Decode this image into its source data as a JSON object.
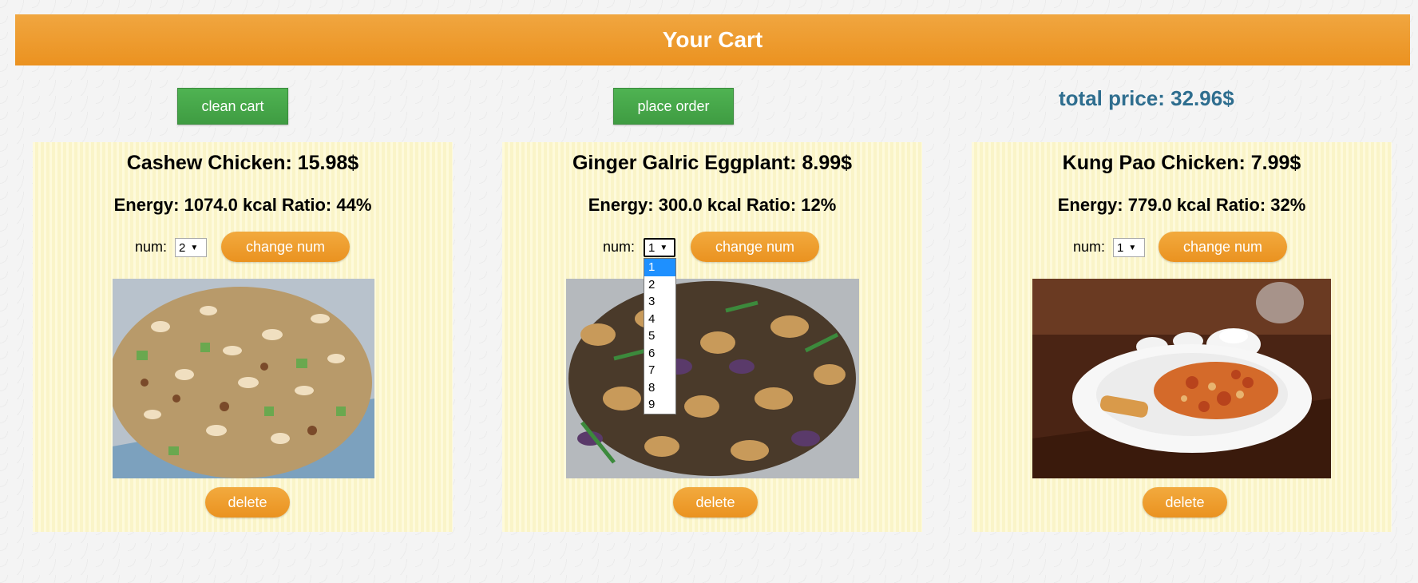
{
  "header": {
    "title": "Your Cart"
  },
  "actions": {
    "clean_label": "clean cart",
    "order_label": "place order",
    "total_text": "total price: 32.96$"
  },
  "colors": {
    "header": "#eb9220",
    "action_button": "#43a047",
    "card_background": "#fdf8cf",
    "total_text": "#2f6e8f",
    "selected_option": "#1e90ff"
  },
  "items": [
    {
      "title": "Cashew Chicken: 15.98$",
      "energy": "Energy: 1074.0 kcal Ratio: 44%",
      "num_label": "num:",
      "num_value": "2",
      "change_label": "change num",
      "delete_label": "delete",
      "image": "cashew-chicken-photo"
    },
    {
      "title": "Ginger Galric Eggplant: 8.99$",
      "energy": "Energy: 300.0 kcal Ratio: 12%",
      "num_label": "num:",
      "num_value": "1",
      "change_label": "change num",
      "delete_label": "delete",
      "image": "eggplant-photo"
    },
    {
      "title": "Kung Pao Chicken: 7.99$",
      "energy": "Energy: 779.0 kcal Ratio: 32%",
      "num_label": "num:",
      "num_value": "1",
      "change_label": "change num",
      "delete_label": "delete",
      "image": "kung-pao-chicken-photo"
    }
  ],
  "dropdown": {
    "options": [
      "1",
      "2",
      "3",
      "4",
      "5",
      "6",
      "7",
      "8",
      "9"
    ],
    "selected": "1"
  }
}
